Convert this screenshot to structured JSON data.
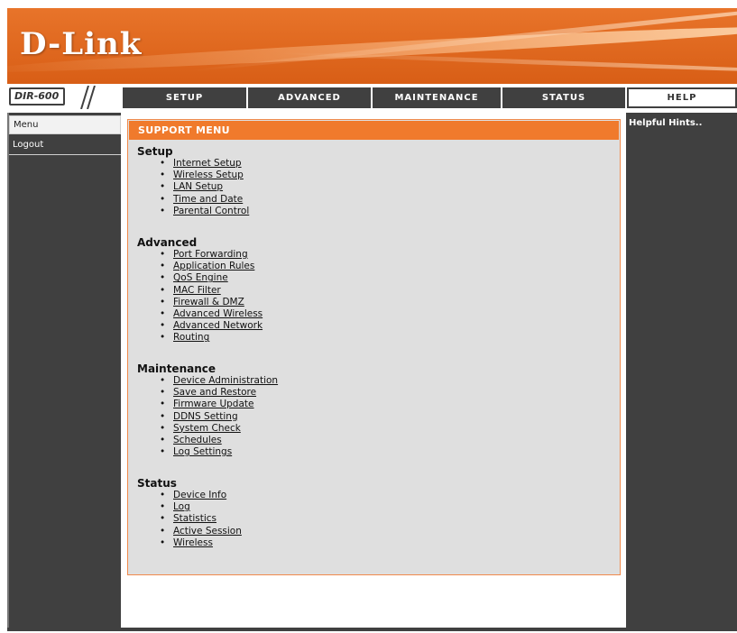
{
  "brand": "D-Link",
  "model": "DIR-600",
  "colors": {
    "accent": "#f07a2c",
    "dark": "#404040",
    "panel": "#dfdfdf"
  },
  "nav": {
    "tabs": [
      "SETUP",
      "ADVANCED",
      "MAINTENANCE",
      "STATUS",
      "HELP"
    ]
  },
  "sidebar": {
    "items": [
      "Menu",
      "Logout"
    ]
  },
  "support": {
    "title": "SUPPORT MENU",
    "sections": [
      {
        "heading": "Setup",
        "links": [
          "Internet Setup",
          "Wireless Setup",
          "LAN Setup",
          "Time and Date",
          "Parental Control"
        ]
      },
      {
        "heading": "Advanced",
        "links": [
          "Port Forwarding",
          "Application Rules",
          "QoS Engine",
          "MAC Filter",
          "Firewall & DMZ",
          "Advanced Wireless",
          "Advanced Network",
          "Routing"
        ]
      },
      {
        "heading": "Maintenance",
        "links": [
          "Device Administration",
          "Save and Restore",
          "Firmware Update",
          "DDNS Setting",
          "System Check",
          "Schedules",
          "Log Settings"
        ]
      },
      {
        "heading": "Status",
        "links": [
          "Device Info",
          "Log",
          "Statistics",
          "Active Session",
          "Wireless"
        ]
      }
    ]
  },
  "help": {
    "hints": "Helpful Hints.."
  }
}
